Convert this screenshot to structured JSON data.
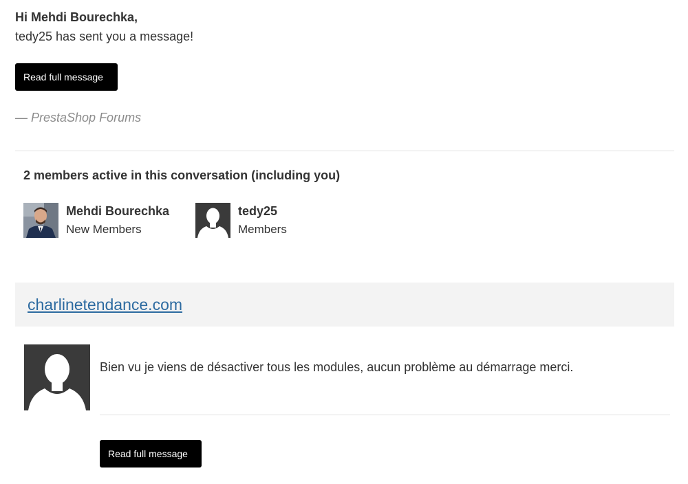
{
  "header": {
    "greeting": "Hi Mehdi Bourechka,",
    "subtitle": "tedy25 has sent you a message!"
  },
  "actions": {
    "read_full_message_top": "Read full message",
    "read_full_message_bottom": "Read full message"
  },
  "signature": "— PrestaShop Forums",
  "members": {
    "title": "2 members active in this conversation (including you)",
    "items": [
      {
        "name": "Mehdi Bourechka",
        "role": "New Members",
        "avatar": "user-photo-avatar"
      },
      {
        "name": "tedy25",
        "role": "Members",
        "avatar": "default-user-silhouette-icon"
      }
    ]
  },
  "topic": {
    "link_text": "charlinetendance.com"
  },
  "post": {
    "avatar": "default-user-silhouette-icon",
    "text": "Bien vu je viens de désactiver tous les modules, aucun problème au démarrage merci."
  },
  "colors": {
    "button_bg": "#000000",
    "button_text": "#ffffff",
    "link": "#2c6aa0",
    "signature": "#8c8c8c",
    "topic_bg": "#f3f3f3",
    "avatar_bg": "#3a3a3a"
  }
}
